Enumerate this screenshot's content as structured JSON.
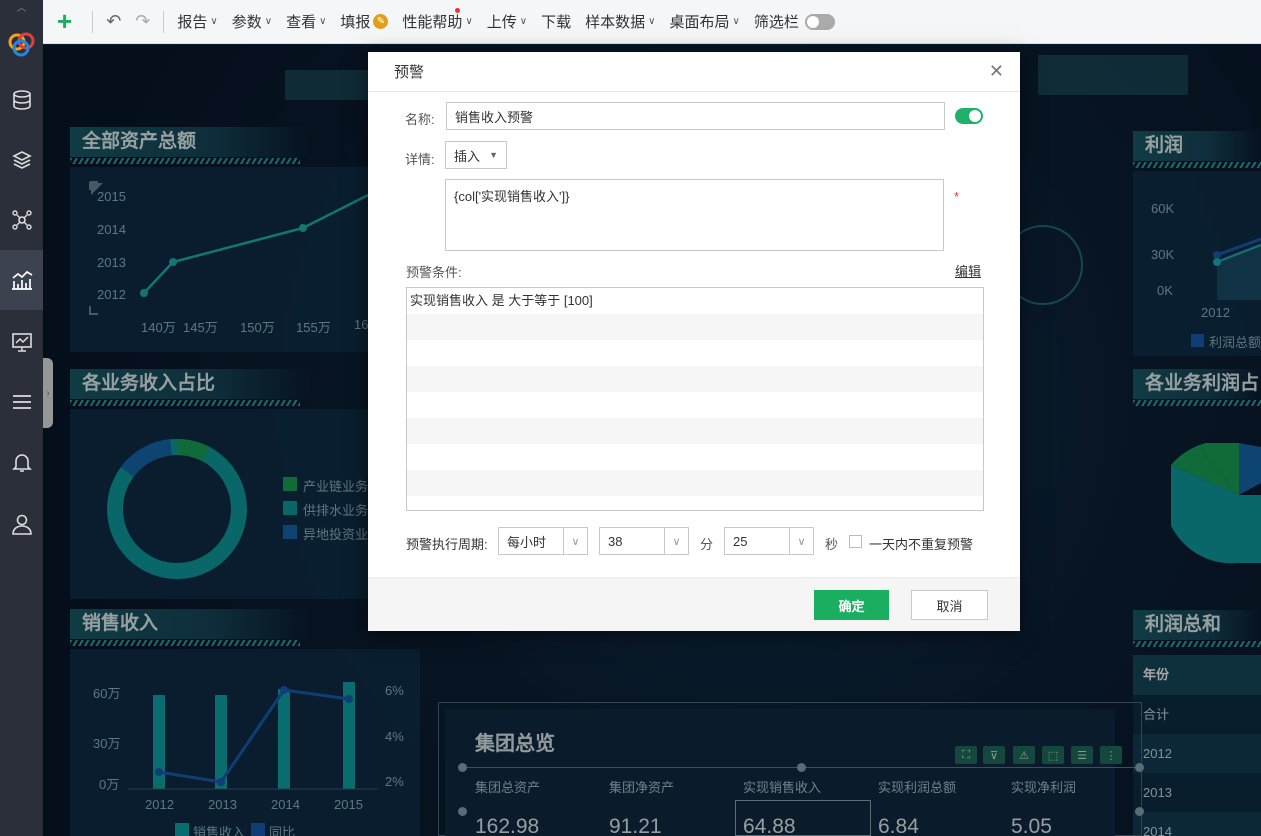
{
  "toolbar": {
    "add": "+",
    "undo": "↶",
    "redo": "↷",
    "menus": [
      "报告",
      "参数",
      "查看",
      "填报",
      "性能帮助",
      "上传",
      "下载",
      "样本数据",
      "桌面布局",
      "筛选栏"
    ]
  },
  "sidebar": {
    "icons": [
      "database-icon",
      "layers-icon",
      "network-icon",
      "chart-icon",
      "monitor-icon",
      "menu-icon",
      "bell-icon",
      "user-icon"
    ]
  },
  "dashboard": {
    "assets_title": "全部资产总额",
    "assets_years": [
      "2015",
      "2014",
      "2013",
      "2012"
    ],
    "assets_x": [
      "140万",
      "145万",
      "150万",
      "155万",
      "16"
    ],
    "share_title": "各业务收入占比",
    "share_legend": [
      "产业链业务",
      "供排水业务",
      "异地投资业"
    ],
    "sales_title": "销售收入",
    "sales_y_left": [
      "60万",
      "30万",
      "0万"
    ],
    "sales_y_right": [
      "6%",
      "4%",
      "2%"
    ],
    "sales_years": [
      "2012",
      "2013",
      "2014",
      "2015"
    ],
    "sales_legend": [
      "销售收入",
      "同比"
    ],
    "profit_title": "利润",
    "profit_y": [
      "60K",
      "30K",
      "0K"
    ],
    "profit_year": "2012",
    "profit_legend": "利润总额",
    "profit_share_title": "各业务利润占",
    "profit_sum_title": "利润总和",
    "profit_sum_rows": [
      "年份",
      "合计",
      "2012",
      "2013",
      "2014"
    ],
    "overview_title": "集团总览",
    "overview_cols": [
      "集团总资产",
      "集团净资产",
      "实现销售收入",
      "实现利润总额",
      "实现净利润"
    ],
    "overview_vals": [
      "162.98",
      "91.21",
      "64.88",
      "6.84",
      "5.05"
    ]
  },
  "dialog": {
    "title": "预警",
    "name_label": "名称:",
    "name_value": "销售收入预警",
    "detail_label": "详情:",
    "insert_label": "插入",
    "detail_text": "{col['实现销售收入']}",
    "required_mark": "*",
    "cond_label": "预警条件:",
    "edit_link": "编辑",
    "cond_rows": [
      "实现销售收入 是 大于等于 [100]",
      "",
      "",
      "",
      "",
      "",
      "",
      "",
      ""
    ],
    "period_label": "预警执行周期:",
    "period_value": "每小时",
    "minute_value": "38",
    "minute_unit": "分",
    "second_value": "25",
    "second_unit": "秒",
    "no_repeat": "一天内不重复预警",
    "ok": "确定",
    "cancel": "取消"
  }
}
